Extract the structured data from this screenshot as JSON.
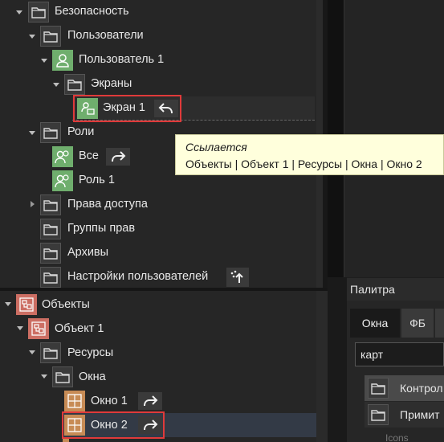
{
  "tree_top": {
    "items": [
      {
        "label": "Безопасность"
      },
      {
        "label": "Пользователи"
      },
      {
        "label": "Пользователь 1"
      },
      {
        "label": "Экраны"
      },
      {
        "label": "Экран 1"
      },
      {
        "label": "Роли"
      },
      {
        "label": "Все"
      },
      {
        "label": "Роль 1"
      },
      {
        "label": "Права доступа"
      },
      {
        "label": "Группы прав"
      },
      {
        "label": "Архивы"
      },
      {
        "label": "Настройки пользователей"
      }
    ]
  },
  "tree_bottom": {
    "items": [
      {
        "label": "Объекты"
      },
      {
        "label": "Объект 1"
      },
      {
        "label": "Ресурсы"
      },
      {
        "label": "Окна"
      },
      {
        "label": "Окно 1"
      },
      {
        "label": "Окно 2"
      }
    ]
  },
  "tooltip": {
    "title": "Ссылается",
    "path": "Объекты | Объект 1 | Ресурсы | Окна | Окно 2"
  },
  "palette": {
    "title": "Палитра",
    "tabs": [
      "Окна",
      "ФБ"
    ],
    "search_value": "карт",
    "items": [
      "Контрол",
      "Примит"
    ],
    "footer": "Icons"
  },
  "colors": {
    "user_icon": "#6fae6d",
    "object_icon": "#cc6e63",
    "window_icon": "#c78b55",
    "highlight_border": "#e03a3a",
    "tooltip_bg": "#ffffdc"
  }
}
